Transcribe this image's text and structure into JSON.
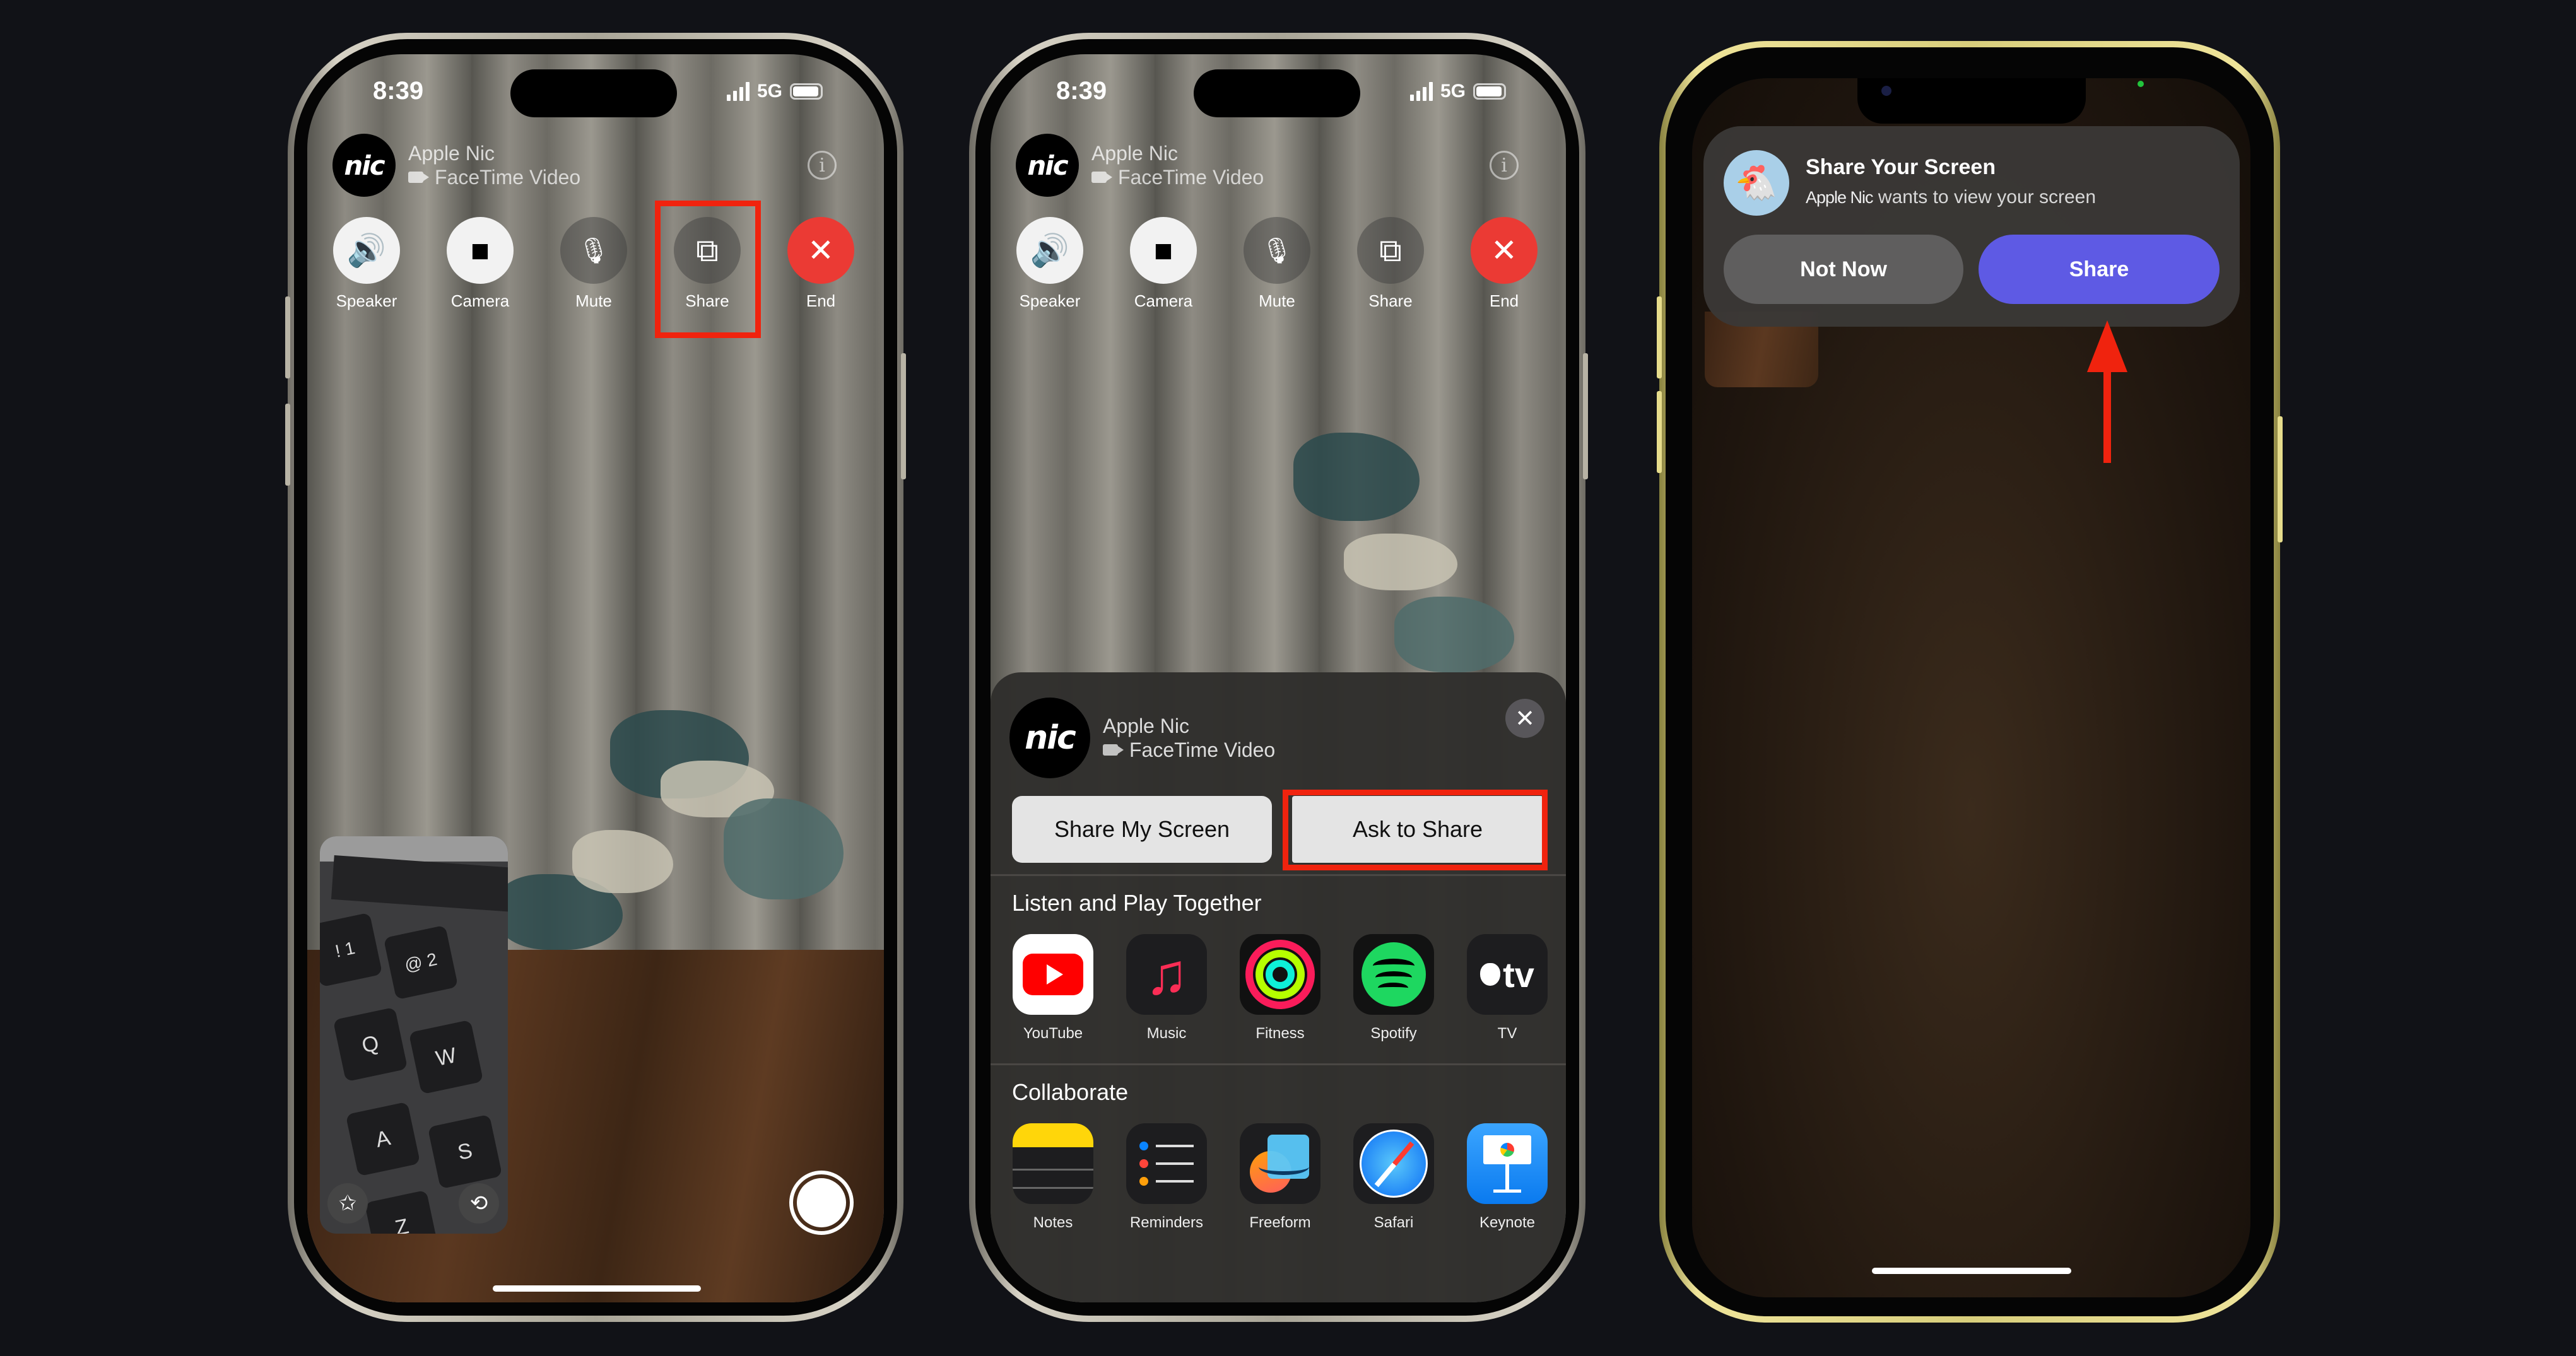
{
  "colors": {
    "page_bg": "#111217",
    "highlight_red": "#f0230e",
    "end_red": "#eb3a34",
    "share_purple": "#5e5ae4",
    "not_now_gray": "#5f5e5e",
    "frame_titanium": "#c9c4b6",
    "frame_yellow": "#e6dc8c"
  },
  "phone1": {
    "status": {
      "time": "8:39",
      "network": "5G",
      "signal_icon": "signal-bars-icon",
      "battery_icon": "battery-icon"
    },
    "caller": {
      "avatar_text": "nic",
      "name": "Apple Nic",
      "subtitle": "FaceTime Video",
      "info_icon": "i"
    },
    "controls": [
      {
        "id": "speaker",
        "label": "Speaker",
        "icon": "speaker-icon",
        "glyph": "🔊"
      },
      {
        "id": "camera",
        "label": "Camera",
        "icon": "video-camera-icon",
        "glyph": "■"
      },
      {
        "id": "mute",
        "label": "Mute",
        "icon": "mic-off-icon",
        "glyph": "🎙"
      },
      {
        "id": "share",
        "label": "Share",
        "icon": "shareplay-icon",
        "glyph": "⧉",
        "highlighted": true
      },
      {
        "id": "end",
        "label": "End",
        "icon": "close-icon",
        "glyph": "✕"
      }
    ],
    "pip": {
      "keys": [
        "! 1",
        "@ 2",
        "Q",
        "W",
        "A",
        "S",
        "Z"
      ],
      "effects_icon": "✩",
      "flip_camera_icon": "⟲"
    },
    "shutter_icon": "shutter-button"
  },
  "phone2": {
    "status": {
      "time": "8:39",
      "network": "5G"
    },
    "caller": {
      "avatar_text": "nic",
      "name": "Apple Nic",
      "subtitle": "FaceTime Video",
      "info_icon": "i"
    },
    "controls": [
      {
        "id": "speaker",
        "label": "Speaker",
        "glyph": "🔊"
      },
      {
        "id": "camera",
        "label": "Camera",
        "glyph": "■"
      },
      {
        "id": "mute",
        "label": "Mute",
        "glyph": "🎙"
      },
      {
        "id": "share",
        "label": "Share",
        "glyph": "⧉"
      },
      {
        "id": "end",
        "label": "End",
        "glyph": "✕"
      }
    ],
    "sheet": {
      "avatar_text": "nic",
      "name": "Apple Nic",
      "subtitle": "FaceTime Video",
      "close_glyph": "✕",
      "share_my_screen": "Share My Screen",
      "ask_to_share": "Ask to Share",
      "ask_to_share_highlighted": true,
      "section_listen": "Listen and Play Together",
      "listen_apps": [
        {
          "name": "YouTube",
          "icon": "youtube-icon"
        },
        {
          "name": "Music",
          "icon": "music-icon",
          "glyph": "♫"
        },
        {
          "name": "Fitness",
          "icon": "fitness-rings-icon"
        },
        {
          "name": "Spotify",
          "icon": "spotify-icon"
        },
        {
          "name": "TV",
          "icon": "apple-tv-icon",
          "glyph": "tv"
        }
      ],
      "section_collaborate": "Collaborate",
      "collab_apps": [
        {
          "name": "Notes",
          "icon": "notes-icon"
        },
        {
          "name": "Reminders",
          "icon": "reminders-icon"
        },
        {
          "name": "Freeform",
          "icon": "freeform-icon"
        },
        {
          "name": "Safari",
          "icon": "safari-icon"
        },
        {
          "name": "Keynote",
          "icon": "keynote-icon"
        }
      ]
    }
  },
  "phone3": {
    "notification": {
      "avatar_glyph": "🐔",
      "title": "Share Your Screen",
      "sender": "Apple Nic",
      "body": " wants to view your screen",
      "not_now": "Not Now",
      "share": "Share"
    },
    "annotation": "red-arrow-pointing-to-share"
  }
}
